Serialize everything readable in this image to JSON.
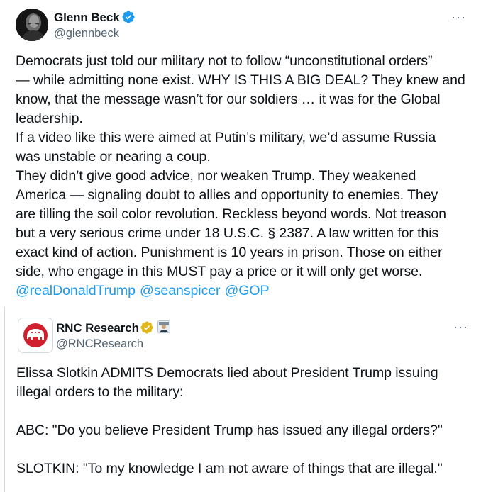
{
  "main_tweet": {
    "author_name": "Glenn Beck",
    "handle": "@glennbeck",
    "more_label": "···",
    "lines": [
      "Democrats just told our military not to follow “unconstitutional orders”",
      "— while admitting none exist. WHY IS THIS A BIG DEAL?  They knew and",
      "know, that the message wasn’t for our soldiers … it was for the Global",
      "leadership.",
      "If a video like this were aimed at Putin’s military, we’d assume Russia",
      "was unstable or nearing a coup.",
      "They didn’t give good advice, nor weaken Trump. They weakened",
      "America — signaling doubt to allies and opportunity to enemies. They",
      "are tilling the soil color revolution.  Reckless beyond words. Not treason",
      "but a very serious crime under 18 U.S.C. § 2387.  A law written for this",
      "exact kind of action.  Punishment is 10 years in prison.   Those on either",
      "side, who engage in this MUST pay a price or it will only get worse."
    ],
    "mentions": [
      "@realDonaldTrump",
      "@seanspicer",
      "@GOP"
    ]
  },
  "quoted_tweet": {
    "author_name": "RNC Research",
    "handle": "@RNCResearch",
    "more_label": "···",
    "lines": {
      "l1": "Elissa Slotkin ADMITS Democrats lied about President Trump issuing",
      "l2": "illegal orders to the military:",
      "l3": "ABC: \"Do you believe President Trump has issued any illegal orders?\"",
      "l4": "SLOTKIN: \"To my knowledge I am not aware of things that are illegal.\""
    }
  },
  "colors": {
    "text": "#0f1419",
    "secondary": "#536471",
    "link": "#1d9bf0",
    "verified_blue": "#1d9bf0",
    "verified_gold": "#e2b719",
    "gop_red": "#d0202e"
  },
  "icons": {
    "verified_main": "verified-badge-blue-icon",
    "verified_rnc": "verified-badge-gold-icon",
    "affiliate": "affiliate-avatar-icon",
    "more": "more-options-icon",
    "rnc_logo": "gop-elephant-logo-icon"
  }
}
